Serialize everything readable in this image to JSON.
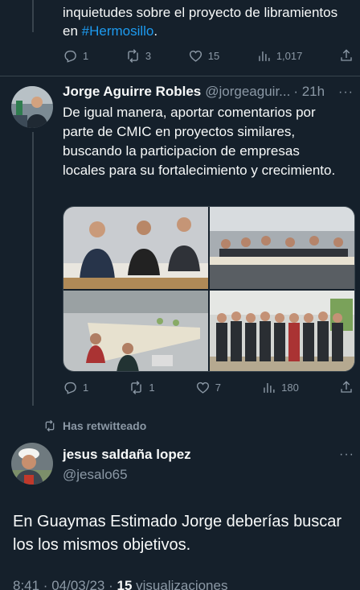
{
  "tweet1": {
    "text_prefix": "inquietudes sobre el proyecto de libramientos en ",
    "hashtag": "#Hermosillo",
    "text_suffix": ".",
    "replies": "1",
    "retweets": "3",
    "likes": "15",
    "views": "1,017"
  },
  "tweet2": {
    "name": "Jorge Aguirre Robles",
    "handle": "@jorgeaguir...",
    "time": "· 21h",
    "text": "De igual manera, aportar comentarios por parte de CMIC en proyectos similares, buscando la participacion de empresas locales para su fortalecimiento y crecimiento.",
    "replies": "1",
    "retweets": "1",
    "likes": "7",
    "views": "180"
  },
  "retweet_label": "Has retwitteado",
  "tweet3": {
    "name": "jesus saldaña lopez",
    "handle": "@jesalo65",
    "text": "En Guaymas Estimado Jorge deberías buscar los los mismos objetivos.",
    "meta_time": "8:41 · 04/03/23 · ",
    "meta_views_count": "15",
    "meta_views_label": " visualizaciones"
  },
  "icons": {
    "reply": "reply-icon",
    "retweet": "retweet-icon",
    "like": "heart-icon",
    "views": "views-icon",
    "share": "share-icon",
    "more": "more-icon"
  },
  "colors": {
    "background": "#15202b",
    "text": "#f7f9f9",
    "secondary": "#8b98a5",
    "accent": "#1d9bf0",
    "divider": "#38444d"
  }
}
